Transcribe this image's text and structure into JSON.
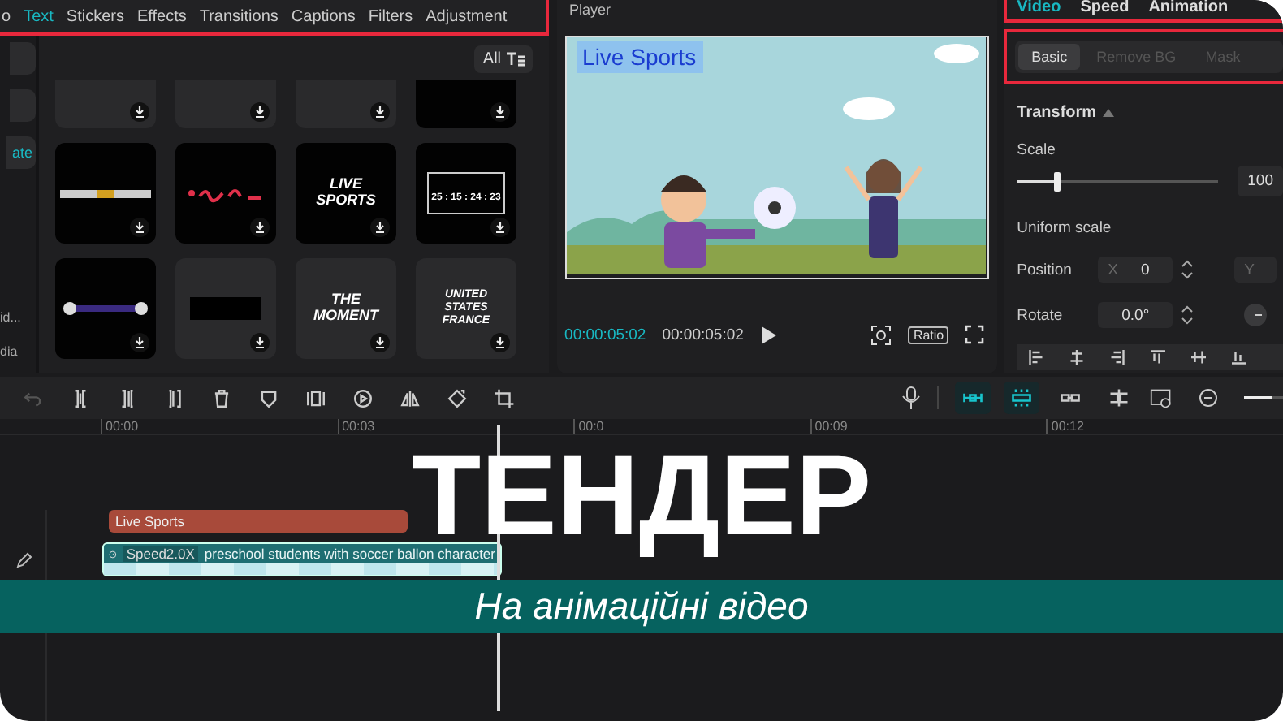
{
  "media_tabs": [
    {
      "label": "o",
      "selected": false
    },
    {
      "label": "Text",
      "selected": true
    },
    {
      "label": "Stickers",
      "selected": false
    },
    {
      "label": "Effects",
      "selected": false
    },
    {
      "label": "Transitions",
      "selected": false
    },
    {
      "label": "Captions",
      "selected": false
    },
    {
      "label": "Filters",
      "selected": false
    },
    {
      "label": "Adjustment",
      "selected": false
    }
  ],
  "sidebar": {
    "button_label": "ate",
    "labels": [
      "id...",
      "dia"
    ]
  },
  "filter": {
    "label": "All"
  },
  "tiles": [
    {
      "kind": "stripe",
      "dark": false
    },
    {
      "kind": "stripe",
      "dark": false
    },
    {
      "kind": "blank",
      "dark": false
    },
    {
      "kind": "banner",
      "dark": true
    },
    {
      "kind": "bar",
      "dark": true
    },
    {
      "kind": "scribble",
      "dark": true
    },
    {
      "kind": "text",
      "dark": true,
      "lines": [
        "LIVE",
        "SPORTS"
      ]
    },
    {
      "kind": "countdown",
      "dark": true,
      "lines": [
        "25 : 15 : 24 : 23"
      ]
    },
    {
      "kind": "lower-third",
      "dark": true
    },
    {
      "kind": "block",
      "dark": false
    },
    {
      "kind": "text",
      "dark": false,
      "lines": [
        "THE",
        "MOMENT"
      ]
    },
    {
      "kind": "text",
      "dark": false,
      "lines": [
        "UNITED STATES",
        "FRANCE"
      ]
    }
  ],
  "player": {
    "title": "Player",
    "overlay_text": "Live Sports",
    "current_time": "00:00:05:02",
    "total_time": "00:00:05:02",
    "ratio_label": "Ratio"
  },
  "inspector": {
    "tabs": [
      {
        "label": "Video",
        "selected": true
      },
      {
        "label": "Speed",
        "selected": false
      },
      {
        "label": "Animation",
        "selected": false
      }
    ],
    "modes": [
      {
        "label": "Basic",
        "selected": true
      },
      {
        "label": "Remove BG",
        "selected": false
      },
      {
        "label": "Mask",
        "selected": false
      }
    ],
    "section": {
      "title": "Transform",
      "expanded": true
    },
    "scale": {
      "label": "Scale",
      "level": 0.2,
      "value": "100"
    },
    "uniform_scale": {
      "label": "Uniform scale"
    },
    "position": {
      "label": "Position",
      "x_label": "X",
      "x_value": "0",
      "y_label": "Y"
    },
    "rotate": {
      "label": "Rotate",
      "value": "0.0°"
    }
  },
  "toolbar": {
    "toggles": [
      {
        "active": true
      },
      {
        "active": true
      },
      {
        "active": false
      },
      {
        "active": false
      }
    ],
    "zoom": {
      "level": 0.7
    }
  },
  "timeline": {
    "ruler": [
      "00:00",
      "00:03",
      "00:0",
      "00:09",
      "00:12"
    ],
    "tracks": [
      {
        "kind": "text",
        "label": "Live Sports"
      },
      {
        "kind": "video",
        "badge": "Speed2.0X",
        "title": "preschool students with soccer ballon character"
      }
    ]
  },
  "overlay": {
    "headline": "ТЕНДЕР",
    "subtitle": "На анімаційні відео"
  }
}
